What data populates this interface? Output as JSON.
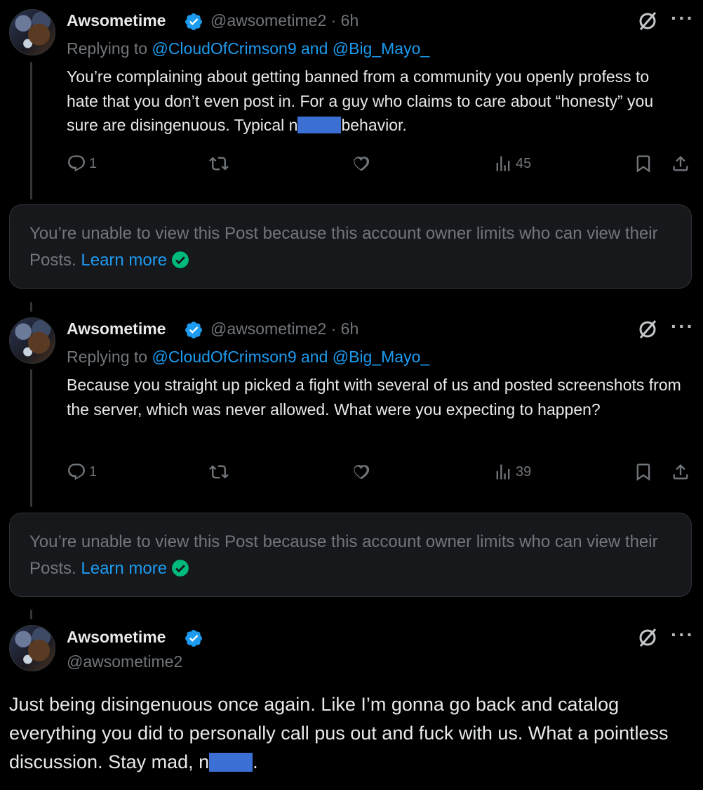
{
  "posts": [
    {
      "name": "Awsometime",
      "handle_time": "@awsometime2 · 6h",
      "replying_prefix": "Replying to ",
      "replying_to": "@CloudOfCrimson9 and @Big_Mayo_",
      "text_before_redact": "You’re complaining about getting banned from a community you openly profess to hate that you don’t even post in. For a guy who claims to care about “honesty” you sure are disingenuous. Typical n",
      "text_after_redact": "behavior.",
      "replies": "1",
      "views": "45"
    },
    {
      "name": "Awsometime",
      "handle_time": "@awsometime2 · 6h",
      "replying_prefix": "Replying to ",
      "replying_to": "@CloudOfCrimson9 and @Big_Mayo_",
      "text": "Because you straight up picked a fight with several of us and posted screenshots from the server, which was never allowed. What were you expecting to happen?",
      "replies": "1",
      "views": "39"
    }
  ],
  "notices": [
    {
      "text": "You’re unable to view this Post because this account owner limits who can view their Posts.",
      "link": "Learn more"
    },
    {
      "text": "You’re unable to view this Post because this account owner limits who can view their Posts.",
      "link": "Learn more"
    }
  ],
  "main_post": {
    "name": "Awsometime",
    "handle": "@awsometime2",
    "text_before_redact": "Just being disingenuous once again. Like I’m gonna go back and catalog everything you did to personally call pus out and fuck with us. What a pointless discussion. Stay mad, n",
    "text_after_redact": "."
  },
  "icons": [
    "reply-icon",
    "repost-icon",
    "like-icon",
    "views-icon",
    "bookmark-icon",
    "share-icon",
    "verified-badge-icon",
    "grok-icon",
    "more-icon"
  ],
  "colors": {
    "background": "#000000",
    "accent": "#1d9bf0",
    "muted": "#71767b",
    "redaction": "#3b6fd4",
    "verified_check": "#00ba7c"
  }
}
